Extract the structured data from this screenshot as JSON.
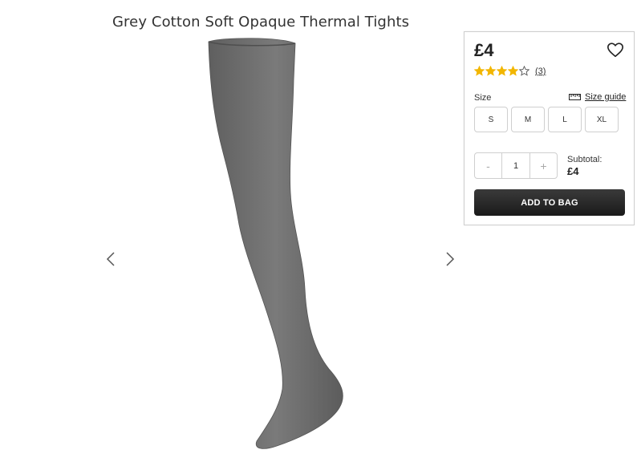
{
  "product": {
    "title": "Grey Cotton Soft Opaque Thermal Tights",
    "price": "£4",
    "rating": 4,
    "rating_max": 5,
    "review_count": "(3)"
  },
  "options": {
    "size_label": "Size",
    "size_guide_label": "Size guide",
    "sizes": [
      "S",
      "M",
      "L",
      "XL"
    ]
  },
  "quantity": {
    "minus": "-",
    "value": "1",
    "plus": "+"
  },
  "subtotal": {
    "label": "Subtotal:",
    "value": "£4"
  },
  "actions": {
    "add_to_bag": "ADD TO BAG"
  },
  "colors": {
    "star": "#f2b600",
    "button_bg": "#222222",
    "product": "#6e6e6e"
  },
  "icons": {
    "prev": "chevron-left-icon",
    "next": "chevron-right-icon",
    "wishlist": "heart-icon",
    "size_guide": "ruler-icon",
    "star": "star-icon"
  }
}
